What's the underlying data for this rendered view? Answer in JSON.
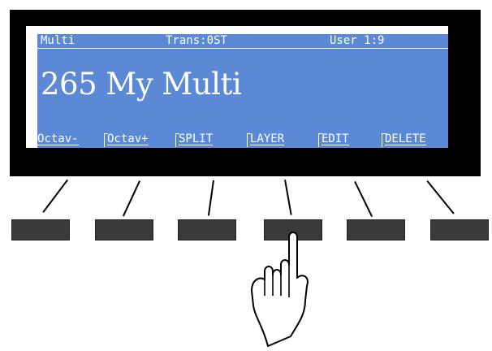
{
  "status": {
    "left": "Multi",
    "middle": "Trans:0ST",
    "right": "User 1:9"
  },
  "title": "265 My Multi",
  "softkeys": [
    "Octav-",
    "Octav+",
    "SPLIT",
    "LAYER",
    "EDIT",
    "DELETE"
  ],
  "colors": {
    "bezel": "#000000",
    "lcd_background": "#5b89d6",
    "lcd_text": "#ffffff",
    "button": "#3a3a3a"
  },
  "icons": {
    "hand": "hand-pointer-icon"
  }
}
